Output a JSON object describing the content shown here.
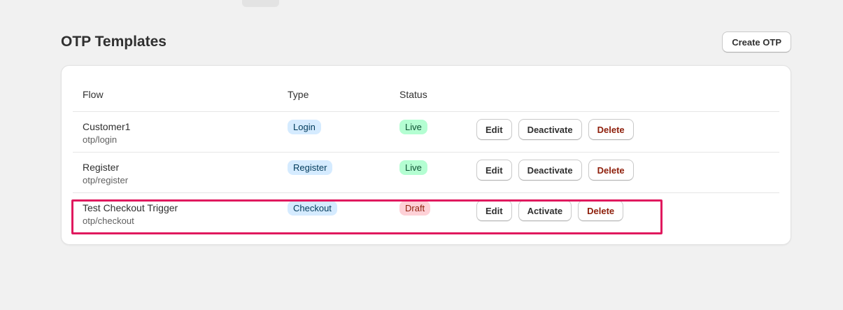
{
  "header": {
    "title": "OTP Templates",
    "create_label": "Create OTP"
  },
  "table": {
    "columns": [
      "Flow",
      "Type",
      "Status"
    ],
    "rows": [
      {
        "name": "Customer1",
        "path": "otp/login",
        "type": "Login",
        "status": "Live",
        "actions": [
          "Edit",
          "Deactivate",
          "Delete"
        ]
      },
      {
        "name": "Register",
        "path": "otp/register",
        "type": "Register",
        "status": "Live",
        "actions": [
          "Edit",
          "Deactivate",
          "Delete"
        ]
      },
      {
        "name": "Test Checkout Trigger",
        "path": "otp/checkout",
        "type": "Checkout",
        "status": "Draft",
        "actions": [
          "Edit",
          "Activate",
          "Delete"
        ]
      }
    ]
  },
  "colors": {
    "background": "#f1f1f1",
    "highlight": "#e0195e",
    "type_badge_bg": "#d5ebff",
    "live_badge_bg": "#b4fed2",
    "draft_badge_bg": "#fed1d7",
    "danger_text": "#8e1f0b"
  }
}
